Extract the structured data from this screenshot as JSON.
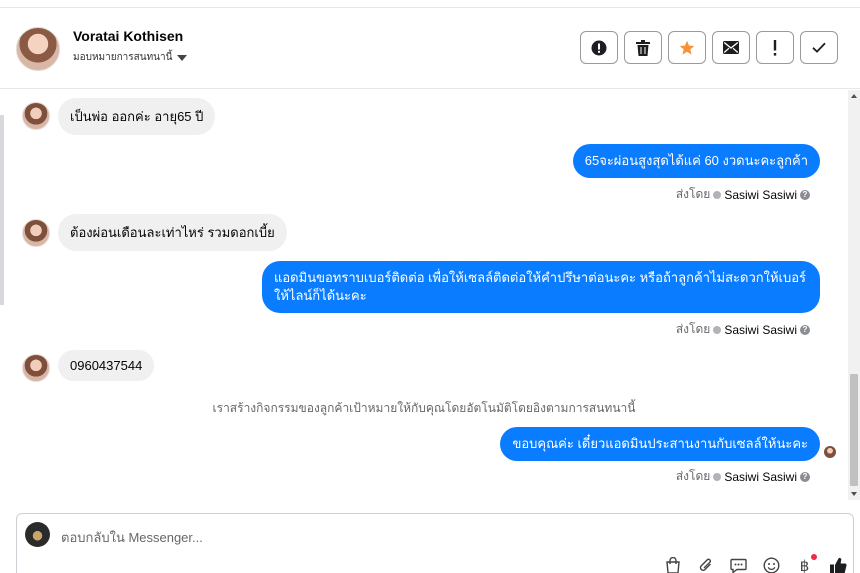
{
  "header": {
    "contact_name": "Voratai Kothisen",
    "assign_label": "มอบหมายการสนทนานี้"
  },
  "actions": [
    {
      "name": "spam",
      "icon": "alert-circle-icon"
    },
    {
      "name": "delete",
      "icon": "trash-icon"
    },
    {
      "name": "star",
      "icon": "star-icon"
    },
    {
      "name": "mark-unread",
      "icon": "envelope-icon"
    },
    {
      "name": "follow-up",
      "icon": "exclamation-icon"
    },
    {
      "name": "done",
      "icon": "check-icon"
    }
  ],
  "messages": [
    {
      "dir": "in",
      "text": "เป็นพ่อ ออกค่ะ อายุ65 ปี"
    },
    {
      "dir": "out",
      "text": "65จะผ่อนสูงสุดได้แค่ 60 งวดนะคะลูกค้า",
      "sent_by_prefix": "ส่งโดย",
      "sent_by_name": "Sasiwi Sasiwi"
    },
    {
      "dir": "in",
      "text": "ต้องผ่อนเดือนละเท่าไหร่ รวมดอกเบี้ย"
    },
    {
      "dir": "out",
      "text": "แอดมินขอทราบเบอร์ติดต่อ เพื่อให้เซลล์ติดต่อให้คำปรึษาต่อนะคะ หรือถ้าลูกค้าไม่สะดวกให้เบอร์ ให้ไลน์ก็ได้นะคะ",
      "sent_by_prefix": "ส่งโดย",
      "sent_by_name": "Sasiwi Sasiwi"
    },
    {
      "dir": "in",
      "text": "0960437544"
    },
    {
      "dir": "system",
      "text": "เราสร้างกิจกรรมของลูกค้าเป้าหมายให้กับคุณโดยอัตโนมัติโดยอิงตามการสนทนานี้"
    },
    {
      "dir": "out",
      "text": "ขอบคุณค่ะ เดี๋ยวแอดมินประสานงานกับเซลล์ให้นะคะ",
      "sent_by_prefix": "ส่งโดย",
      "sent_by_name": "Sasiwi Sasiwi"
    }
  ],
  "composer": {
    "placeholder": "ตอบกลับใน Messenger..."
  },
  "tools": [
    "shopping-bag-icon",
    "paperclip-icon",
    "saved-reply-icon",
    "emoji-icon",
    "baht-icon",
    "thumbs-up-icon"
  ],
  "colors": {
    "outgoing": "#0a7cff",
    "incoming": "#f0f0f0",
    "star": "#f7923b",
    "notification": "#f02849"
  }
}
